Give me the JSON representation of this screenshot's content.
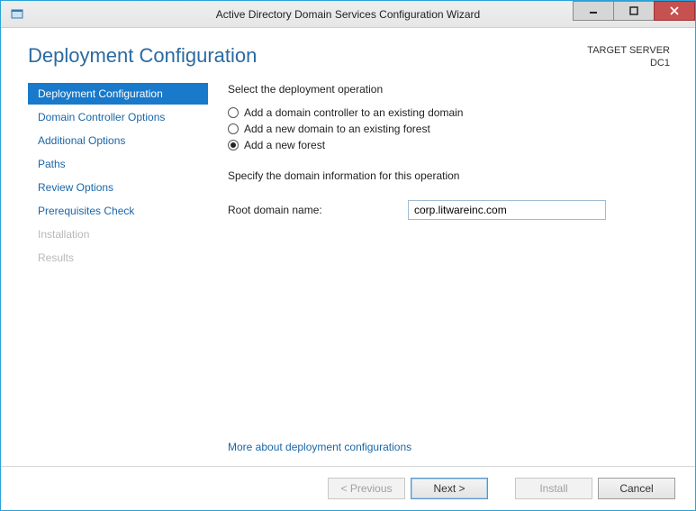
{
  "window": {
    "title": "Active Directory Domain Services Configuration Wizard"
  },
  "header": {
    "page_title": "Deployment Configuration",
    "target_label": "TARGET SERVER",
    "target_value": "DC1"
  },
  "sidebar": {
    "steps": [
      {
        "label": "Deployment Configuration",
        "state": "active"
      },
      {
        "label": "Domain Controller Options",
        "state": "normal"
      },
      {
        "label": "Additional Options",
        "state": "normal"
      },
      {
        "label": "Paths",
        "state": "normal"
      },
      {
        "label": "Review Options",
        "state": "normal"
      },
      {
        "label": "Prerequisites Check",
        "state": "normal"
      },
      {
        "label": "Installation",
        "state": "disabled"
      },
      {
        "label": "Results",
        "state": "disabled"
      }
    ]
  },
  "panel": {
    "select_operation_label": "Select the deployment operation",
    "options": [
      {
        "label": "Add a domain controller to an existing domain",
        "selected": false
      },
      {
        "label": "Add a new domain to an existing forest",
        "selected": false
      },
      {
        "label": "Add a new forest",
        "selected": true
      }
    ],
    "specify_label": "Specify the domain information for this operation",
    "root_domain_label": "Root domain name:",
    "root_domain_value": "corp.litwareinc.com",
    "more_link": "More about deployment configurations"
  },
  "footer": {
    "previous": "< Previous",
    "next": "Next >",
    "install": "Install",
    "cancel": "Cancel"
  }
}
